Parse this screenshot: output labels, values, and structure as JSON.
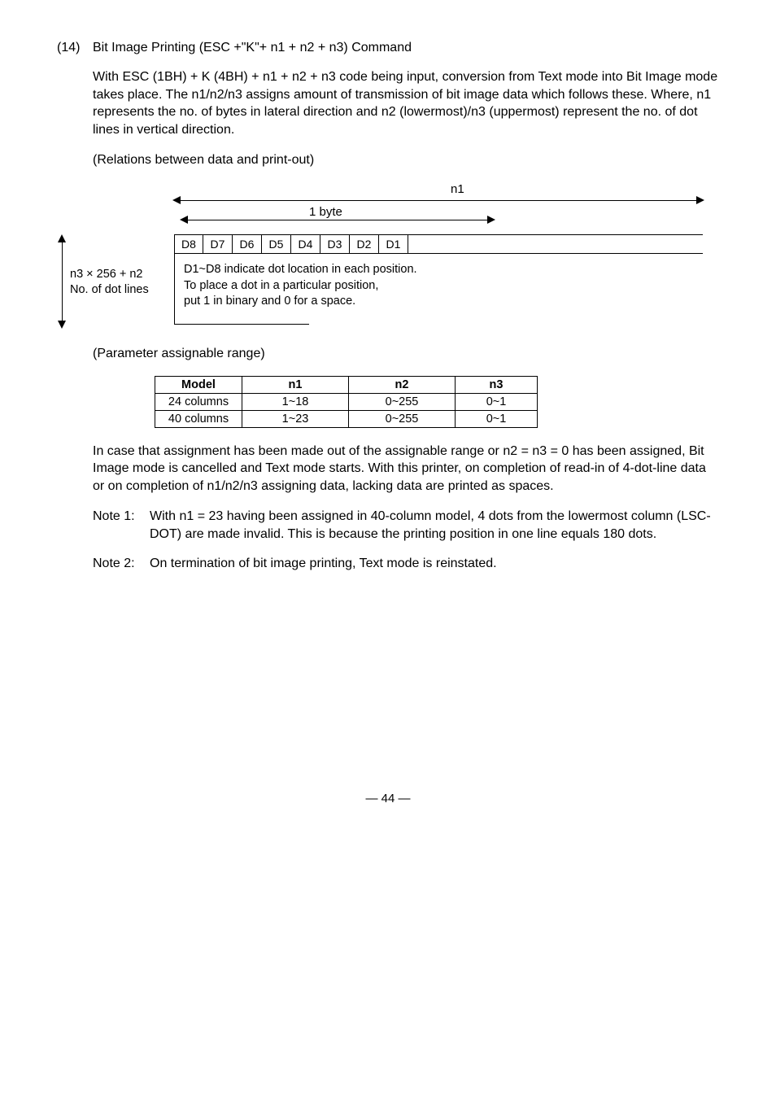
{
  "section": {
    "num": "(14)",
    "title": "Bit Image Printing (ESC +\"K\"+ n1 + n2 + n3) Command"
  },
  "intro": "With ESC (1BH) + K (4BH) + n1 + n2 + n3 code being input, conversion from Text mode into Bit Image mode takes place.  The n1/n2/n3 assigns amount of transmission of bit image data which follows these.  Where, n1 represents the no. of bytes in lateral direction and n2 (lowermost)/n3 (uppermost) represent the no. of dot lines in vertical direction.",
  "relations_heading": "(Relations between data and print-out)",
  "diagram": {
    "n1_label": "n1",
    "byte_label": "1 byte",
    "bits": [
      "D8",
      "D7",
      "D6",
      "D5",
      "D4",
      "D3",
      "D2",
      "D1"
    ],
    "v_label_1": "n3 × 256 + n2",
    "v_label_2": "No. of dot lines",
    "desc_1": "D1~D8 indicate dot location in each position.",
    "desc_2": "To place a dot in a particular position,",
    "desc_3": "put 1 in binary and 0 for a space."
  },
  "param_heading": "(Parameter assignable range)",
  "param_table": {
    "headers": {
      "model": "Model",
      "n1": "n1",
      "n2": "n2",
      "n3": "n3"
    },
    "rows": [
      {
        "model": "24 columns",
        "n1": "1~18",
        "n2": "0~255",
        "n3": "0~1"
      },
      {
        "model": "40 columns",
        "n1": "1~23",
        "n2": "0~255",
        "n3": "0~1"
      }
    ]
  },
  "after_table": "In case that assignment has been made out of the assignable range or n2 = n3 = 0 has been assigned, Bit Image mode is cancelled and Text mode starts. With this printer, on completion of read-in of 4-dot-line data or on completion of n1/n2/n3 assigning data, lacking data are printed as spaces.",
  "note1": {
    "label": "Note 1:",
    "text": "With n1 = 23 having been assigned in 40-column model, 4 dots from the lowermost column (LSC-DOT) are made invalid.  This is because the printing position in one line equals 180 dots."
  },
  "note2": {
    "label": "Note 2:",
    "text": "On termination of bit image printing, Text mode is reinstated."
  },
  "page": "— 44 —"
}
